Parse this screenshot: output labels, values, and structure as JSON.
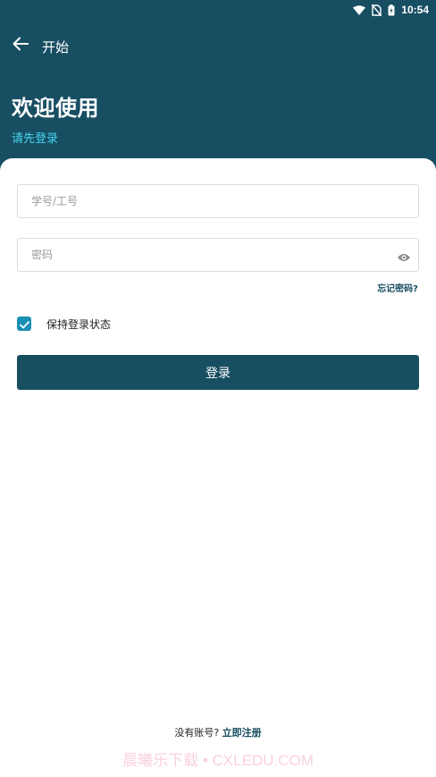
{
  "status_bar": {
    "time": "10:54",
    "icons": [
      "wifi-icon",
      "no-sim-icon",
      "battery-icon"
    ]
  },
  "app_bar": {
    "back_icon": "arrow-left-icon",
    "title": "开始"
  },
  "welcome": {
    "title": "欢迎使用",
    "subtitle": "请先登录"
  },
  "form": {
    "username_placeholder": "学号/工号",
    "username_value": "",
    "password_placeholder": "密码",
    "password_value": "",
    "password_toggle_icon": "eye-icon",
    "forgot_label": "忘记密码?",
    "keep_logged_in_label": "保持登录状态",
    "keep_logged_in_checked": true,
    "login_label": "登录"
  },
  "footer": {
    "no_account_text": "没有账号? ",
    "register_link": "立即注册",
    "watermark": "晨曦乐下载 • CXLEDU.COM"
  },
  "colors": {
    "header_bg": "#174e62",
    "subtitle": "#48d4ee",
    "checkbox": "#1a8fb5",
    "primary_button": "#174e62"
  }
}
